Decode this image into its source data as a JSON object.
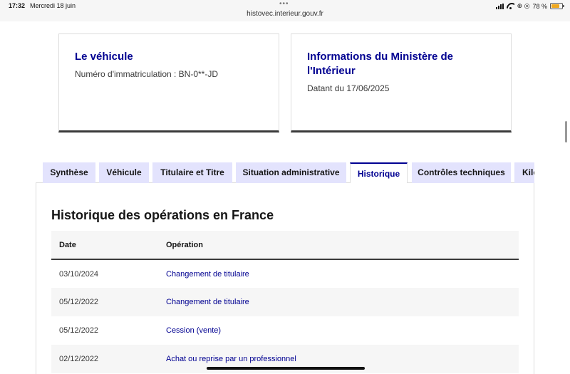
{
  "statusbar": {
    "time": "17:32",
    "date": "Mercredi 18 juin",
    "dots": "•••",
    "url": "histovec.interieur.gouv.fr",
    "status_icons": "⊕ ◎",
    "battery_percent": "78 %",
    "battery_level": 0.78
  },
  "cards": [
    {
      "title": "Le véhicule",
      "text": "Numéro d'immatriculation : BN-0**-JD"
    },
    {
      "title": "Informations du Ministère de l'Intérieur",
      "text": "Datant du 17/06/2025"
    }
  ],
  "tabs": [
    {
      "label": "Synthèse",
      "active": false
    },
    {
      "label": "Véhicule",
      "active": false
    },
    {
      "label": "Titulaire et Titre",
      "active": false
    },
    {
      "label": "Situation administrative",
      "active": false
    },
    {
      "label": "Historique",
      "active": true
    },
    {
      "label": "Contrôles techniques",
      "active": false
    },
    {
      "label": "Kilométrage",
      "active": false
    }
  ],
  "history": {
    "title": "Historique des opérations en France",
    "columns": [
      "Date",
      "Opération"
    ],
    "rows": [
      {
        "date": "03/10/2024",
        "operation": "Changement de titulaire"
      },
      {
        "date": "05/12/2022",
        "operation": "Changement de titulaire"
      },
      {
        "date": "05/12/2022",
        "operation": "Cession (vente)"
      },
      {
        "date": "02/12/2022",
        "operation": "Achat ou reprise par un professionnel"
      }
    ]
  },
  "colors": {
    "accent": "#000091",
    "tab_bg": "#e3e3fd",
    "battery": "#f0a81e"
  }
}
